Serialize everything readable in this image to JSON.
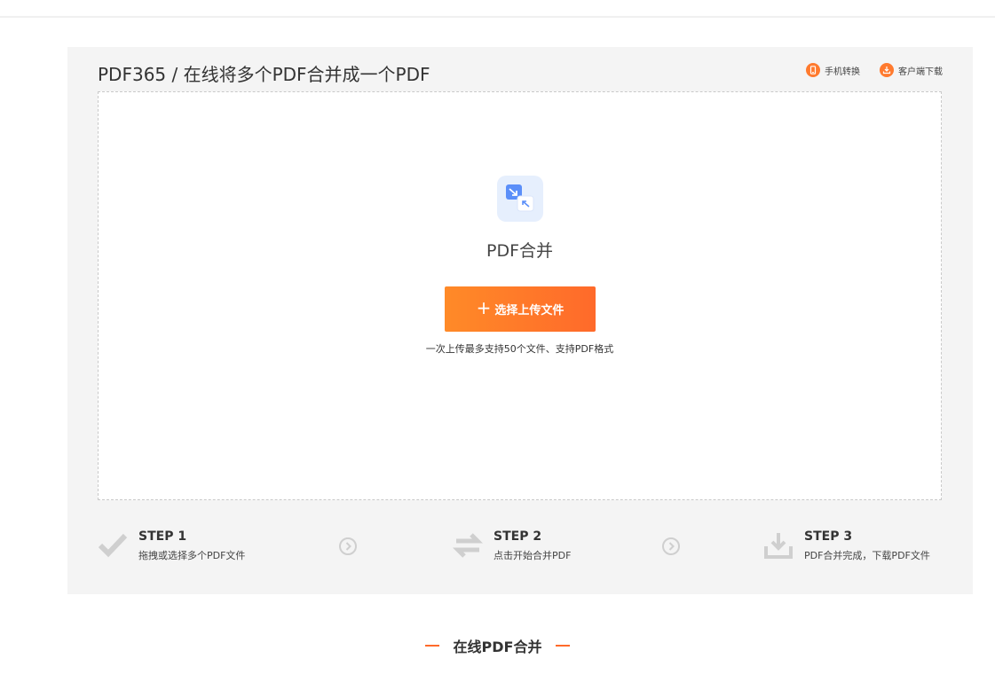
{
  "header": {
    "title": "PDF365 / 在线将多个PDF合并成一个PDF",
    "links": [
      {
        "label": "手机转换",
        "icon": "phone-icon"
      },
      {
        "label": "客户端下载",
        "icon": "download-icon"
      }
    ]
  },
  "upload": {
    "tool_icon": "merge-files-icon",
    "tool_name": "PDF合并",
    "button_label": "选择上传文件",
    "button_icon": "plus-icon",
    "hint": "一次上传最多支持50个文件、支持PDF格式"
  },
  "steps": [
    {
      "title": "STEP 1",
      "desc": "拖拽或选择多个PDF文件",
      "icon": "check-icon"
    },
    {
      "title": "STEP 2",
      "desc": "点击开始合并PDF",
      "icon": "swap-arrows-icon"
    },
    {
      "title": "STEP 3",
      "desc": "PDF合并完成，下载PDF文件",
      "icon": "download-tray-icon"
    }
  ],
  "section": {
    "heading": "在线PDF合并"
  },
  "colors": {
    "accent": "#ff6a2a",
    "panel_bg": "#f4f4f4",
    "icon_gray": "#cfcfcf"
  }
}
